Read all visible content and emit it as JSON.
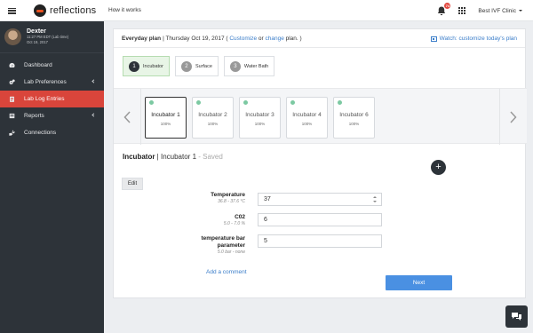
{
  "brand": {
    "name": "reflections"
  },
  "topnav": {
    "how_it_works": "How it works"
  },
  "notifications": {
    "count": "74"
  },
  "clinic": {
    "name": "Best IVF Clinic"
  },
  "profile": {
    "name": "Dexter",
    "time": "11:27 PM EDT (Lab time)",
    "date": "Oct 19, 2017"
  },
  "sidebar": {
    "items": [
      {
        "label": "Dashboard",
        "icon": "speedometer-icon",
        "active": false,
        "expandable": false
      },
      {
        "label": "Lab Preferences",
        "icon": "cogs-icon",
        "active": false,
        "expandable": true
      },
      {
        "label": "Lab Log Entries",
        "icon": "clipboard-icon",
        "active": true,
        "expandable": false
      },
      {
        "label": "Reports",
        "icon": "report-icon",
        "active": false,
        "expandable": true
      },
      {
        "label": "Connections",
        "icon": "plug-icon",
        "active": false,
        "expandable": false
      }
    ]
  },
  "plan": {
    "title": "Everyday plan",
    "date_text": "| Thursday Oct 19, 2017 (",
    "customize": "Customize",
    "or": "or",
    "change": "change",
    "plan_suffix": "plan. )",
    "watch": "Watch: customize today's plan"
  },
  "equipment_tabs": [
    {
      "num": "1",
      "label": "Incubator",
      "active": true
    },
    {
      "num": "2",
      "label": "Surface",
      "active": false
    },
    {
      "num": "3",
      "label": "Water Bath",
      "active": false
    }
  ],
  "units": [
    {
      "name": "Incubator 1",
      "percent": "100%",
      "selected": true
    },
    {
      "name": "Incubator 2",
      "percent": "100%",
      "selected": false
    },
    {
      "name": "Incubator 3",
      "percent": "100%",
      "selected": false
    },
    {
      "name": "Incubator 4",
      "percent": "100%",
      "selected": false
    },
    {
      "name": "Incubator 6",
      "percent": "100%",
      "selected": false
    }
  ],
  "section": {
    "type": "Incubator",
    "separator": " | ",
    "unit": "Incubator 1",
    "saved": " - Saved"
  },
  "form": {
    "edit_label": "Edit",
    "fields": [
      {
        "label": "Temperature",
        "range": "36.8 - 37.6 °C",
        "value": "37"
      },
      {
        "label": "C02",
        "range": "5.0 - 7.0 %",
        "value": "6"
      },
      {
        "label": "temperature bar parameter",
        "range": "5.0 bar - none",
        "value": "5"
      }
    ],
    "add_comment": "Add a comment",
    "next_label": "Next"
  },
  "colors": {
    "sidebar_bg": "#2d3339",
    "active_item": "#d9453b",
    "link": "#3a7dc9",
    "primary_button": "#4a90e2",
    "status_dot": "#7cc9a2"
  }
}
